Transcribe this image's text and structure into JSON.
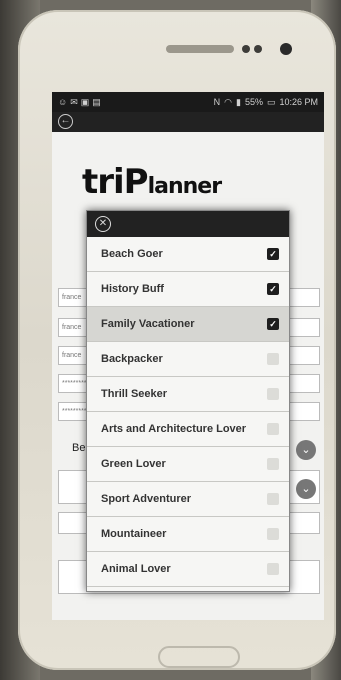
{
  "status_bar": {
    "time": "10:26 PM",
    "battery": "55%"
  },
  "background_form": {
    "fields": [
      "france",
      "france",
      "france",
      "**********",
      "**********"
    ],
    "label": "Be"
  },
  "dialog": {
    "options": [
      {
        "label": "Beach Goer",
        "checked": true
      },
      {
        "label": "History Buff",
        "checked": true
      },
      {
        "label": "Family Vacationer",
        "checked": true,
        "highlighted": true
      },
      {
        "label": "Backpacker",
        "checked": false
      },
      {
        "label": "Thrill Seeker",
        "checked": false
      },
      {
        "label": "Arts and Architecture Lover",
        "checked": false
      },
      {
        "label": "Green Lover",
        "checked": false
      },
      {
        "label": "Sport Adventurer",
        "checked": false
      },
      {
        "label": "Mountaineer",
        "checked": false
      },
      {
        "label": "Animal Lover",
        "checked": false
      }
    ]
  }
}
